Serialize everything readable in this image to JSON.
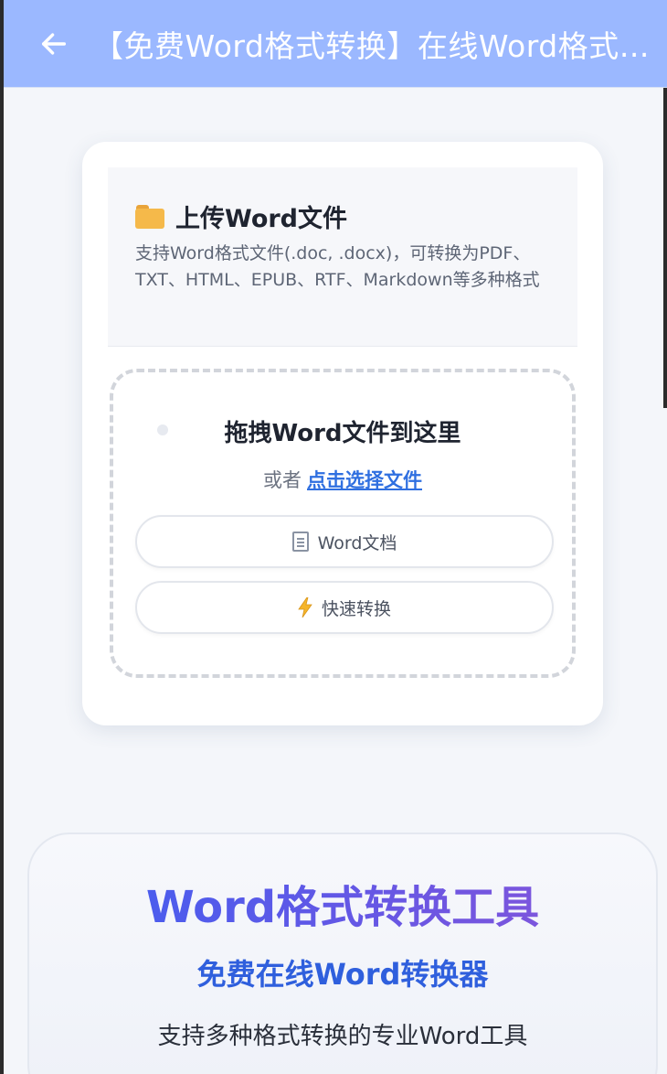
{
  "header": {
    "title": "【免费Word格式转换】在线Word格式转换工具",
    "back_icon": "arrow-left-icon",
    "background": "#9bb8ff"
  },
  "upload": {
    "title": "上传Word文件",
    "folder_icon": "folder-icon",
    "description": "支持Word格式文件(.doc, .docx)，可转换为PDF、TXT、HTML、EPUB、RTF、Markdown等多种格式",
    "drop_title": "拖拽Word文件到这里",
    "drop_or": "或者",
    "choose_file_link": "点击选择文件",
    "pill_doc": {
      "icon": "document-icon",
      "label": "Word文档"
    },
    "pill_fast": {
      "icon": "lightning-icon",
      "label": "快速转换"
    }
  },
  "intro": {
    "title": "Word格式转换工具",
    "subtitle": "免费在线Word转换器",
    "description": "支持多种格式转换的专业Word工具",
    "accent": "#3e5ff2"
  }
}
